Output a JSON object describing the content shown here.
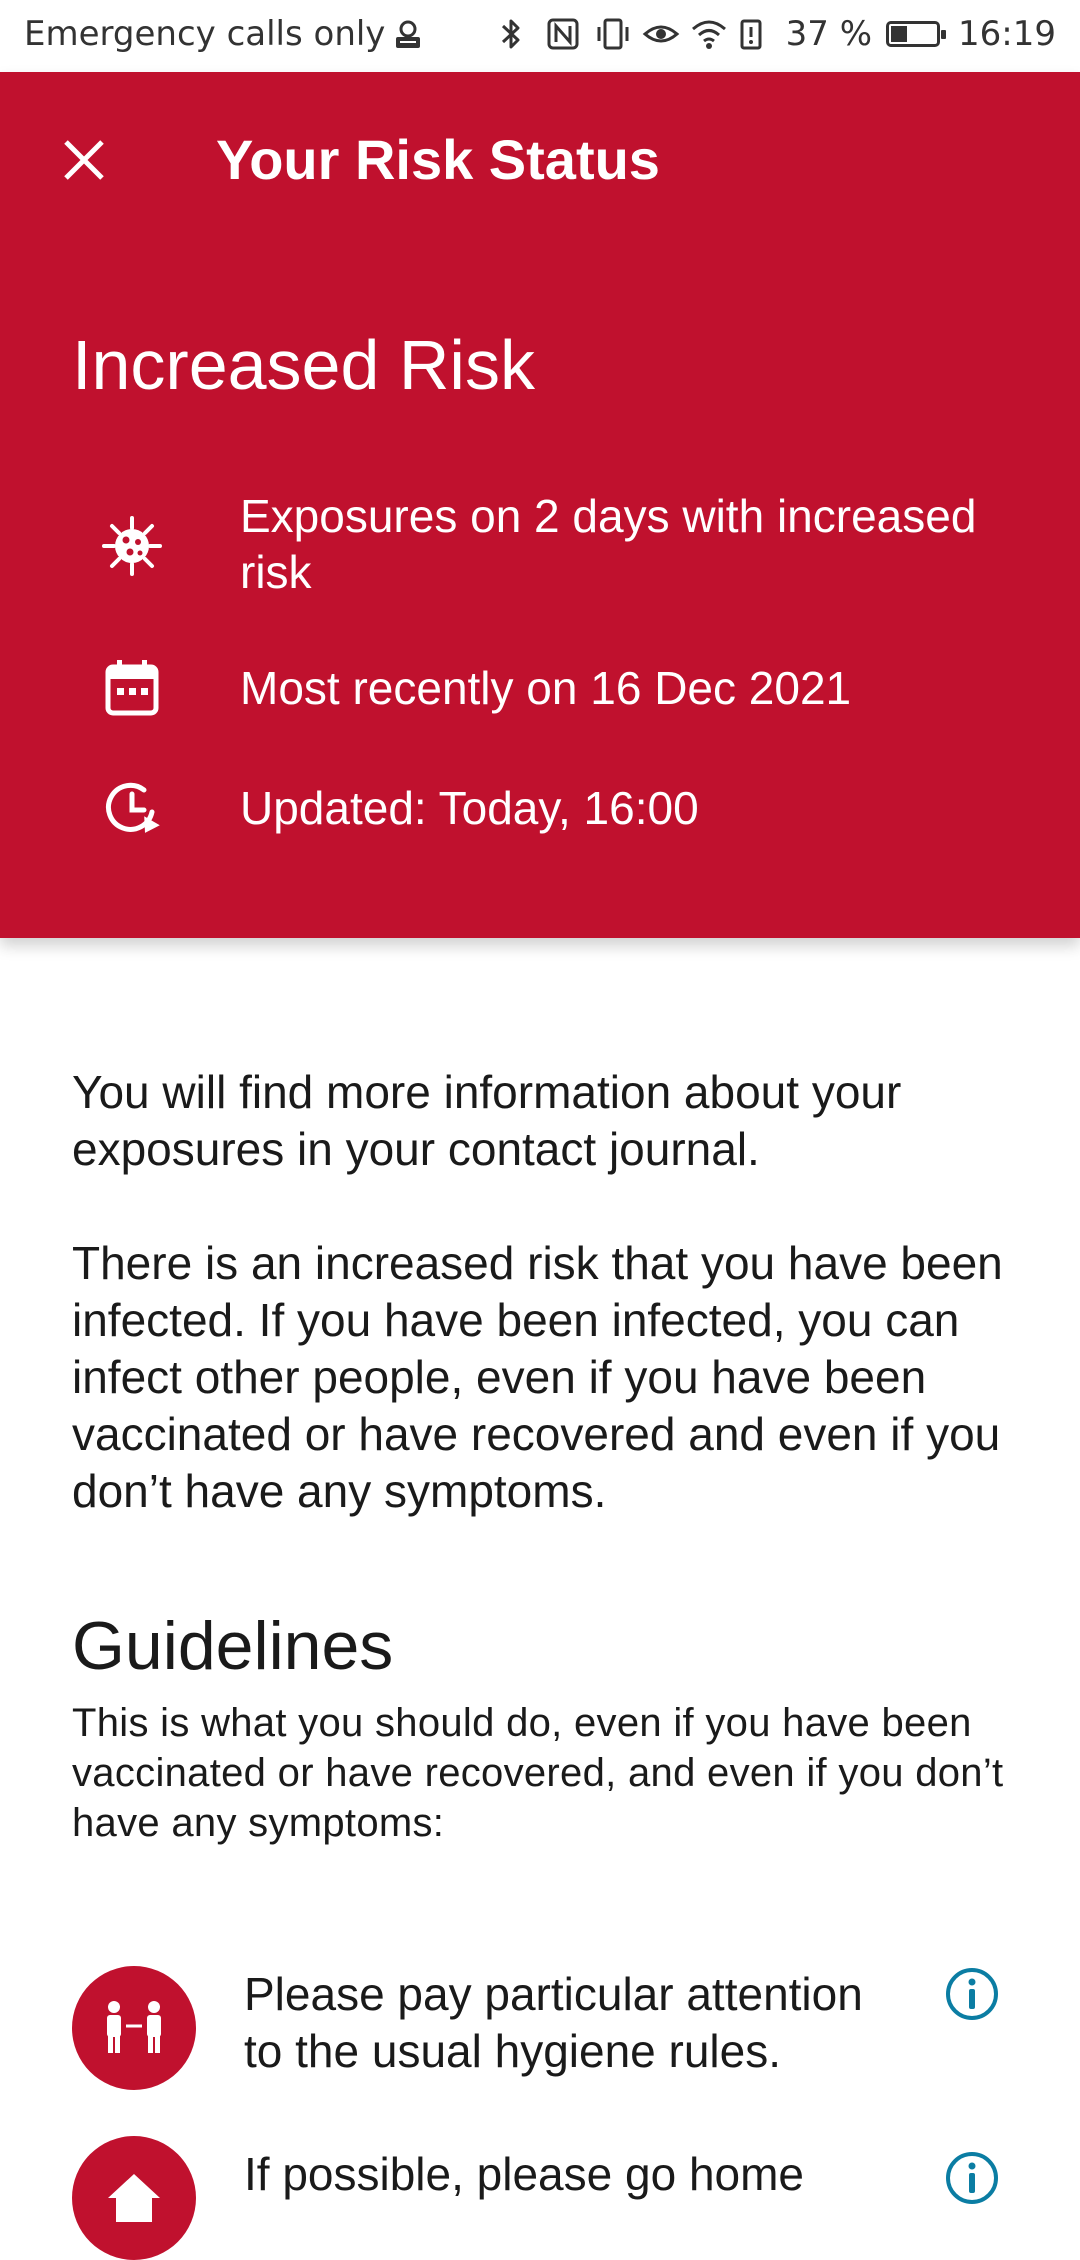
{
  "status_bar": {
    "carrier_text": "Emergency calls only",
    "battery_percent": "37 %",
    "battery_level": 0.37,
    "time": "16:19",
    "icons": [
      "privacy-icon",
      "bluetooth-icon",
      "nfc-icon",
      "vibrate-icon",
      "eye-comfort-icon",
      "wifi-icon",
      "battery-alert-icon",
      "battery-icon"
    ]
  },
  "header": {
    "title": "Your Risk Status",
    "risk_level": "Increased Risk",
    "background_color": "#c0112e",
    "rows": [
      {
        "icon": "virus-icon",
        "text": "Exposures on 2 days with increased risk"
      },
      {
        "icon": "calendar-icon",
        "text": "Most recently on 16 Dec 2021"
      },
      {
        "icon": "update-clock-icon",
        "text": "Updated: Today, 16:00"
      }
    ]
  },
  "body": {
    "paragraph_1": "You will find more information about your exposures in your contact journal.",
    "paragraph_2": "There is an increased risk that you have been infected. If you have been infected, you can infect other people, even if you have been vaccinated or have recovered and even if you don’t have any symptoms.",
    "guidelines_title": "Guidelines",
    "guidelines_subtitle": "This is what you should do, even if you have been vaccinated or have recovered, and even if you don’t have any symptoms:",
    "guidelines": [
      {
        "icon": "distance-people-icon",
        "text": "Please pay particular attention to the usual hygiene rules."
      },
      {
        "icon": "home-icon",
        "text": "If possible, please go home"
      }
    ]
  },
  "colors": {
    "accent_red": "#c0112e",
    "info_teal": "#0b7da3"
  }
}
